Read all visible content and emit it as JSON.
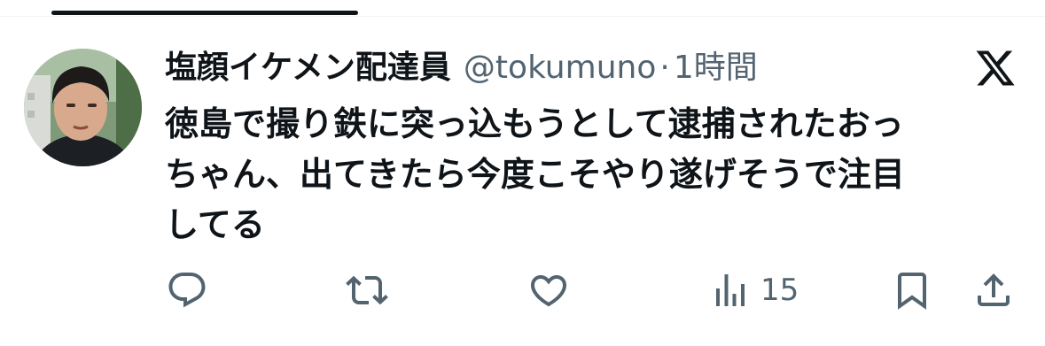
{
  "tweet": {
    "display_name": "塩顔イケメン配達員",
    "handle": "@tokumuno",
    "separator": "·",
    "time": "1時間",
    "text": "徳島で撮り鉄に突っ込もうとして逮捕されたおっ\nちゃん、出てきたら今度こそやり遂げそうで注目\nしてる"
  },
  "actions": {
    "views_count": "15"
  },
  "icons": {
    "brand": "x-logo-icon",
    "reply": "reply-icon",
    "repost": "repost-icon",
    "like": "like-icon",
    "views": "views-icon",
    "bookmark": "bookmark-icon",
    "share": "share-icon"
  },
  "colors": {
    "text": "#0f1419",
    "secondary": "#536471",
    "divider": "#eff3f4"
  }
}
